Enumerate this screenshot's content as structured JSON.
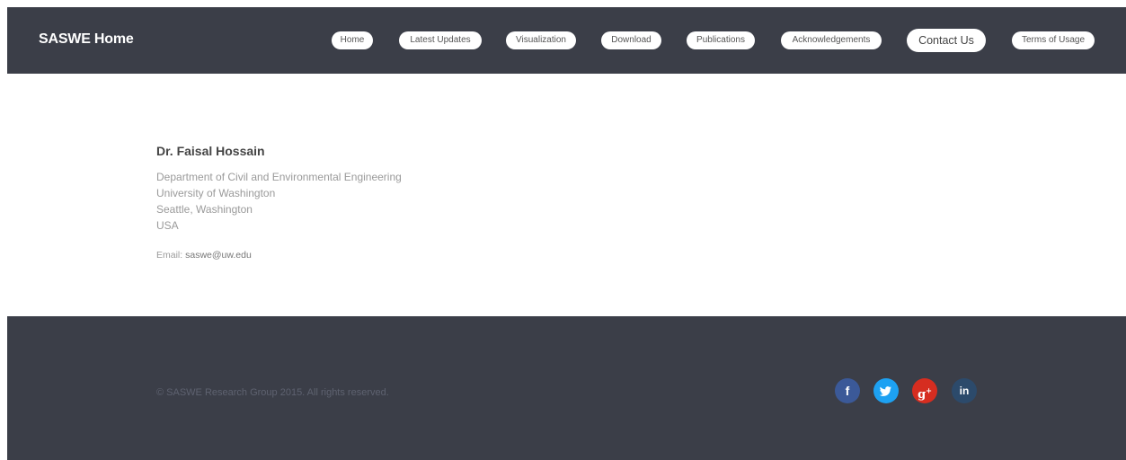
{
  "header": {
    "brand": "SASWE Home",
    "nav": [
      {
        "label": "Home"
      },
      {
        "label": "Latest Updates"
      },
      {
        "label": "Visualization"
      },
      {
        "label": "Download"
      },
      {
        "label": "Publications"
      },
      {
        "label": "Acknowledgements"
      },
      {
        "label": "Contact Us"
      },
      {
        "label": "Terms of Usage"
      }
    ]
  },
  "contact": {
    "name": "Dr. Faisal Hossain",
    "address": [
      "Department of Civil and Environmental Engineering",
      "University of Washington",
      "Seattle, Washington",
      "USA"
    ],
    "email_label": "Email:",
    "email": "saswe@uw.edu"
  },
  "footer": {
    "copyright": "© SASWE Research Group 2015. All rights reserved.",
    "social": [
      {
        "icon": "facebook-icon",
        "glyph": "f",
        "color": "#3b5998"
      },
      {
        "icon": "twitter-icon",
        "glyph": "t",
        "color": "#1da1f2"
      },
      {
        "icon": "google-plus-icon",
        "glyph": "g+",
        "color": "#d62d20"
      },
      {
        "icon": "linkedin-icon",
        "glyph": "in",
        "color": "#2c4a6b"
      }
    ]
  },
  "colors": {
    "header_bg": "#3b3e48",
    "footer_bg": "#3b3e48"
  }
}
